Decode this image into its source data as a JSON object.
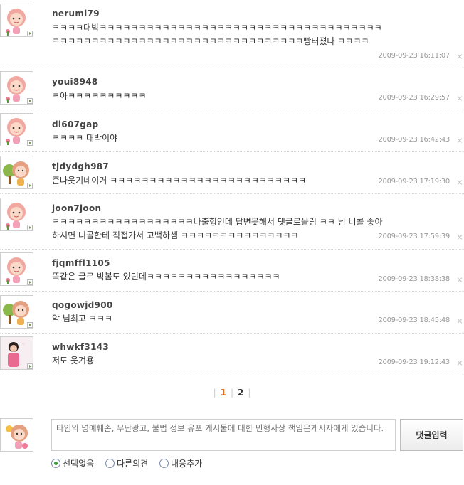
{
  "comments": [
    {
      "user": "nerumi79",
      "text": "ㅋㅋㅋㅋ대박ㅋㅋㅋㅋㅋㅋㅋㅋㅋㅋㅋㅋㅋㅋㅋㅋㅋㅋㅋㅋㅋㅋㅋㅋㅋㅋㅋㅋㅋㅋㅋㅋㅋㅋㅋㅋㅋㅋㅋㅋㅋㅋㅋㅋㅋㅋㅋㅋㅋㅋㅋㅋㅋㅋㅋㅋㅋㅋㅋㅋㅋㅋㅋㅋㅋㅋㅋㅋ빵터졌다 ㅋㅋㅋㅋ",
      "date": "2009-09-23 16:11:07",
      "avatar": "girl-monkey-icon"
    },
    {
      "user": "youi8948",
      "text": "ㅋ아ㅋㅋㅋㅋㅋㅋㅋㅋㅋㅋ",
      "date": "2009-09-23 16:29:57",
      "avatar": "girl-monkey-icon"
    },
    {
      "user": "dl607gap",
      "text": "ㅋㅋㅋㅋ 대박이야",
      "date": "2009-09-23 16:42:43",
      "avatar": "girl-monkey-icon"
    },
    {
      "user": "tjdydgh987",
      "text": "존나웃기네이거 ㅋㅋㅋㅋㅋㅋㅋㅋㅋㅋㅋㅋㅋㅋㅋㅋㅋㅋㅋㅋㅋㅋㅋㅋㅋ",
      "date": "2009-09-23 17:19:30",
      "avatar": "tree-monkey-icon"
    },
    {
      "user": "joon7joon",
      "text": "ㅋㅋㅋㅋㅋㅋㅋㅋㅋㅋㅋㅋㅋㅋㅋㅋㅋㅋ나출힝인데 답변못해서 댓글로올림 ㅋㅋ 님 니콜 좋아하시면 니콜한테 직접가서 고백하셈 ㅋㅋㅋㅋㅋㅋㅋㅋㅋㅋㅋㅋㅋㅋㅋ",
      "date": "2009-09-23 17:59:39",
      "avatar": "girl-monkey-icon"
    },
    {
      "user": "fjqmffl1105",
      "text": "똑같은 글로 박봄도 있던데ㅋㅋㅋㅋㅋㅋㅋㅋㅋㅋㅋㅋㅋㅋㅋㅋㅋ",
      "date": "2009-09-23 18:38:38",
      "avatar": "girl-monkey-icon"
    },
    {
      "user": "qogowjd900",
      "text": "악 님최고 ㅋㅋㅋ",
      "date": "2009-09-23 18:45:48",
      "avatar": "tree-monkey-icon"
    },
    {
      "user": "whwkf3143",
      "text": "저도 웃겨용",
      "date": "2009-09-23 19:12:43",
      "avatar": "photo-avatar-icon"
    }
  ],
  "pager": {
    "current": "1",
    "next": "2"
  },
  "write": {
    "placeholder": "타인의 명예훼손, 무단광고, 불법 정보 유포 게시물에 대한 민형사상 책임은게시자에게 있습니다.",
    "submit": "댓글입력",
    "options": [
      "선택없음",
      "다른의견",
      "내용추가"
    ],
    "selected_option": "선택없음"
  },
  "colors": {
    "accent": "#e06a1a",
    "radio_on": "#3a9a3a"
  }
}
